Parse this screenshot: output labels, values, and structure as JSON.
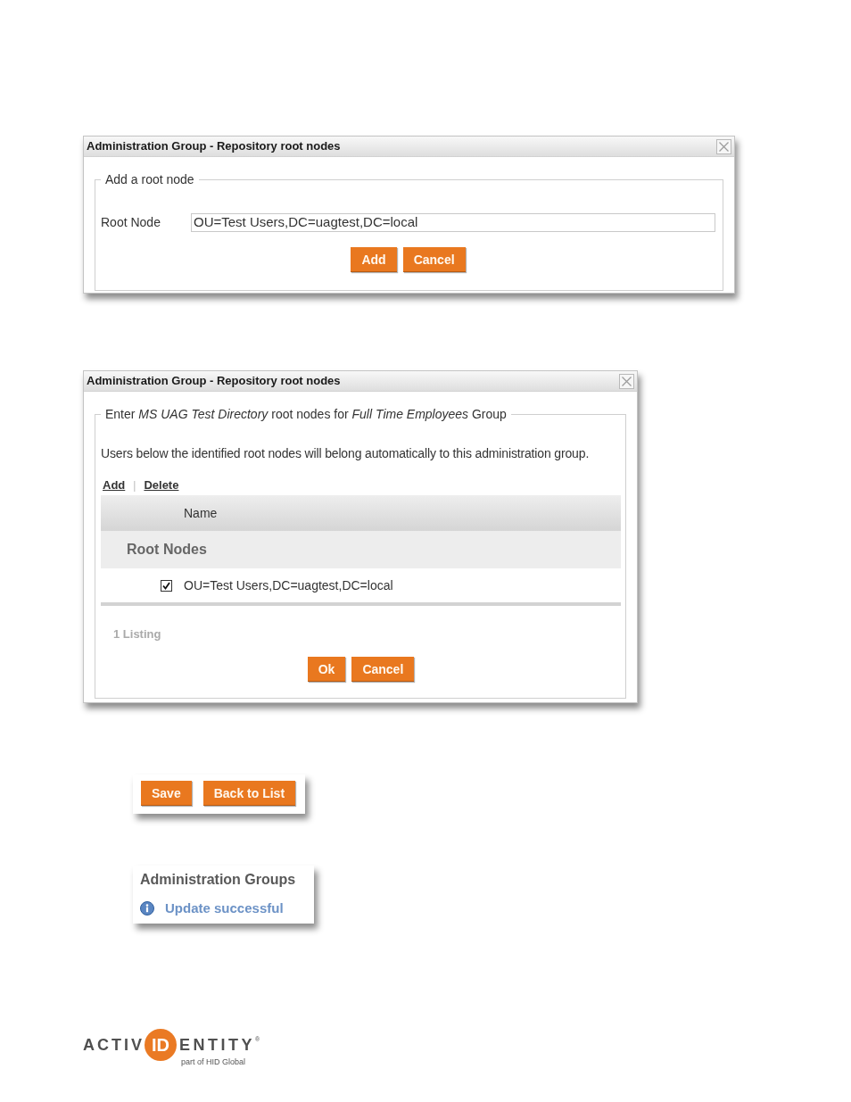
{
  "dialogs": [
    {
      "kind": "add_form",
      "title": "Administration Group - Repository root nodes",
      "legend": "Add a root node",
      "field": {
        "label": "Root Node",
        "value": "OU=Test Users,DC=uagtest,DC=local"
      },
      "buttons": [
        "Add",
        "Cancel"
      ]
    },
    {
      "kind": "list",
      "title": "Administration Group - Repository root nodes",
      "legend": "Enter *MS UAG Test Directory* root nodes for *Full Time Employees* Group",
      "description": "Users below the identified root nodes will belong automatically to this administration group.",
      "actions": [
        "Add",
        "Delete"
      ],
      "separator": "|",
      "table": {
        "columns": [
          "Name"
        ],
        "groups": [
          {
            "label": "Root Nodes",
            "rows": [
              {
                "name": "OU=Test Users,DC=uagtest,DC=local",
                "checked": true
              }
            ]
          }
        ]
      },
      "count": "1 Listing",
      "buttons": [
        "Ok",
        "Cancel"
      ]
    }
  ],
  "save_bar": {
    "buttons": [
      "Save",
      "Back to List"
    ]
  },
  "status_panel": {
    "title": "Administration Groups",
    "message": "Update successful"
  },
  "logo": {
    "left": "ACTIV",
    "mark": "ID",
    "right": "ENTITY",
    "registered": "®",
    "tagline": "part of HID Global"
  }
}
